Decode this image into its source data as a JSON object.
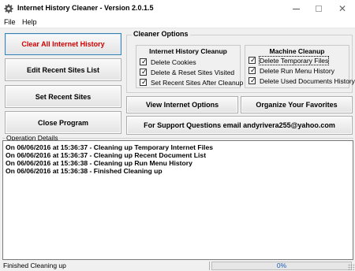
{
  "window": {
    "title": "Internet History Cleaner - Version 2.0.1.5",
    "icon": "gear-icon",
    "controls": {
      "minimize": "minimize-icon",
      "maximize": "maximize-icon",
      "close": "✕"
    }
  },
  "menu": [
    "File",
    "Help"
  ],
  "left_buttons": [
    {
      "label": "Clear All Internet History",
      "color": "#d00000"
    },
    {
      "label": "Edit Recent Sites List"
    },
    {
      "label": "Set Recent Sites"
    },
    {
      "label": "Close Program"
    }
  ],
  "cleaner_options": {
    "title": "Cleaner Options",
    "internet_history": {
      "title": "Internet History Cleanup",
      "items": [
        {
          "label": "Delete Cookies",
          "checked": true
        },
        {
          "label": "Delete & Reset Sites Visited",
          "checked": true
        },
        {
          "label": "Set Recent Sites After Cleanup",
          "checked": true
        }
      ]
    },
    "machine": {
      "title": "Machine Cleanup",
      "items": [
        {
          "label": "Delete Temporary Files",
          "checked": true
        },
        {
          "label": "Delete Run Menu History",
          "checked": true
        },
        {
          "label": "Delete Used Documents History",
          "checked": true
        }
      ]
    }
  },
  "right_buttons": {
    "view_options": "View Internet Options",
    "organize_favorites": "Organize Your Favorites",
    "support": "For Support Questions email andyrivera255@yahoo.com"
  },
  "operation_details": {
    "label": "Operation Details",
    "lines": [
      "On 06/06/2016 at 15:36:37 - Cleaning up Temporary Internet Files",
      "On 06/06/2016 at 15:36:37 - Cleaning up Recent Document List",
      "On 06/06/2016 at 15:36:38 - Cleaning up Run Menu History",
      "On 06/06/2016 at 15:36:38 - Finished Cleaning up"
    ]
  },
  "status": {
    "text": "Finished Cleaning up",
    "progress_text": "0%",
    "progress_fraction": 0,
    "progress_color": "#06b025"
  }
}
